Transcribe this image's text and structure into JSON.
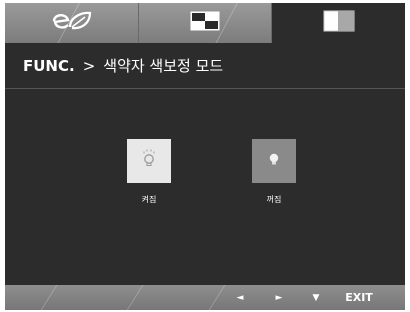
{
  "tabs": [
    {
      "name": "eco-mode",
      "icon": "eco-leaf-icon",
      "active": false
    },
    {
      "name": "picture",
      "icon": "picture-split-icon",
      "active": false
    },
    {
      "name": "function",
      "icon": "panel-split-icon",
      "active": true
    }
  ],
  "header": {
    "func": "FUNC.",
    "separator": ">",
    "title": "색약자 색보정 모드"
  },
  "options": [
    {
      "label": "켜짐",
      "icon": "bulb-on-icon",
      "selected": true
    },
    {
      "label": "꺼짐",
      "icon": "bulb-off-icon",
      "selected": false
    }
  ],
  "footer": {
    "left": "◄",
    "right": "►",
    "down": "▼",
    "exit": "EXIT"
  },
  "colors": {
    "panel_bg": "#2c2c2c",
    "tab_bg": "#8a8a8a",
    "option_on_bg": "#e8e8e8",
    "option_off_bg": "#8a8a8a"
  }
}
